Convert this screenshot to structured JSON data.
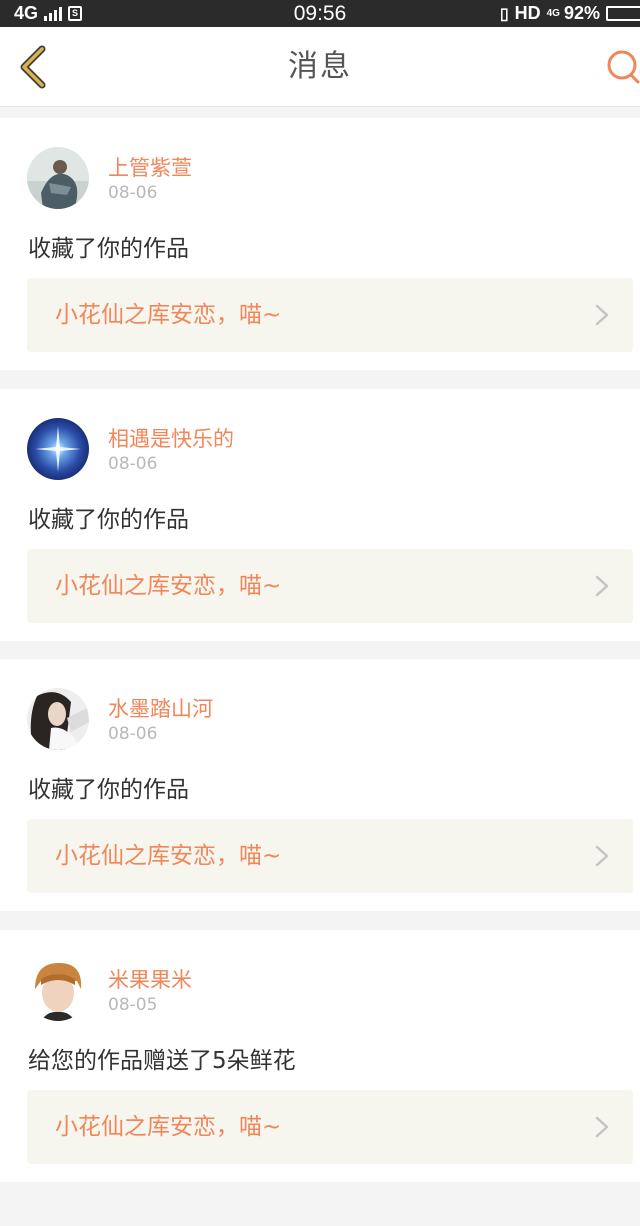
{
  "status_bar": {
    "network": "4G",
    "sim": "S",
    "time": "09:56",
    "hd": "HD",
    "net2": "4G",
    "battery": "92%"
  },
  "header": {
    "title": "消息",
    "back_icon": "chevron-left-icon",
    "search_icon": "search-icon"
  },
  "colors": {
    "accent": "#f0875a",
    "back_arrow": "#d9b44a",
    "link_bg": "#f6f5ee"
  },
  "messages": [
    {
      "username": "上管紫萱",
      "date": "08-06",
      "action": "收藏了你的作品",
      "work_title": "小花仙之库安恋，喵~"
    },
    {
      "username": "相遇是快乐的",
      "date": "08-06",
      "action": "收藏了你的作品",
      "work_title": "小花仙之库安恋，喵~"
    },
    {
      "username": "水墨踏山河",
      "date": "08-06",
      "action": "收藏了你的作品",
      "work_title": "小花仙之库安恋，喵~"
    },
    {
      "username": "米果果米",
      "date": "08-05",
      "action": "给您的作品赠送了5朵鲜花",
      "work_title": "小花仙之库安恋，喵~"
    }
  ]
}
